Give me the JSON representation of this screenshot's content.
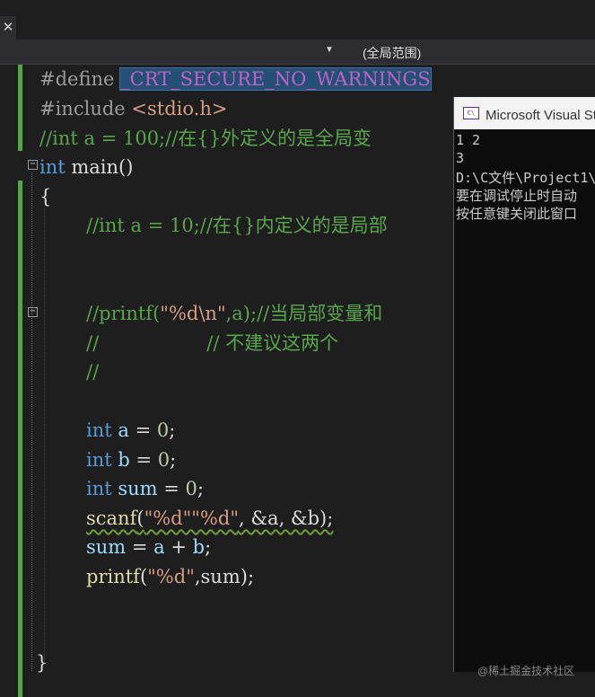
{
  "tab": {
    "close_glyph": "✕"
  },
  "navbar": {
    "scope_label": "(全局范围)"
  },
  "code": {
    "l1_directive": "#define",
    "l1_macro": "_CRT_SECURE_NO_WARNINGS",
    "l2_directive": "#include",
    "l2_header": "<stdio.h>",
    "l3_comment": "//int a = 100;//在{}外定义的是全局变",
    "l4_kw": "int",
    "l4_rest": " main()",
    "l5": "{",
    "l6_comment": "//int a = 10;//在{}内定义的是局部",
    "l7_comment_a": "//printf(",
    "l7_str": "\"%d\\n\"",
    "l7_comment_b": ",a);//当局部变量和",
    "l8_comment": "//                  // 不建议这两个",
    "l9_comment": "//",
    "l10_kw": "int",
    "l10_var": "a",
    "l10_rest": " = ",
    "l10_num": "0",
    "l10_end": ";",
    "l11_kw": "int",
    "l11_var": "b",
    "l11_rest": " = ",
    "l11_num": "0",
    "l11_end": ";",
    "l12_kw": "int",
    "l12_var": "sum",
    "l12_rest": " = ",
    "l12_num": "0",
    "l12_end": ";",
    "l13_fn": "scanf",
    "l13_open": "(",
    "l13_str": "\"%d\"\"%d\"",
    "l13_args": ", &a, &b);",
    "l14_var1": "sum",
    "l14_op1": " = ",
    "l14_var2": "a",
    "l14_op2": " + ",
    "l14_var3": "b",
    "l14_end": ";",
    "l15_fn": "printf",
    "l15_open": "(",
    "l15_str": "\"%d\"",
    "l15_rest": ",sum);",
    "l16": "}"
  },
  "console": {
    "title": "Microsoft Visual Studio 调试控制台",
    "icon_label": "C\\",
    "lines": [
      "1 2",
      "3",
      "D:\\C文件\\Project1\\",
      "要在调试停止时自动",
      "按任意键关闭此窗口"
    ]
  },
  "watermark": "@稀土掘金技术社区"
}
